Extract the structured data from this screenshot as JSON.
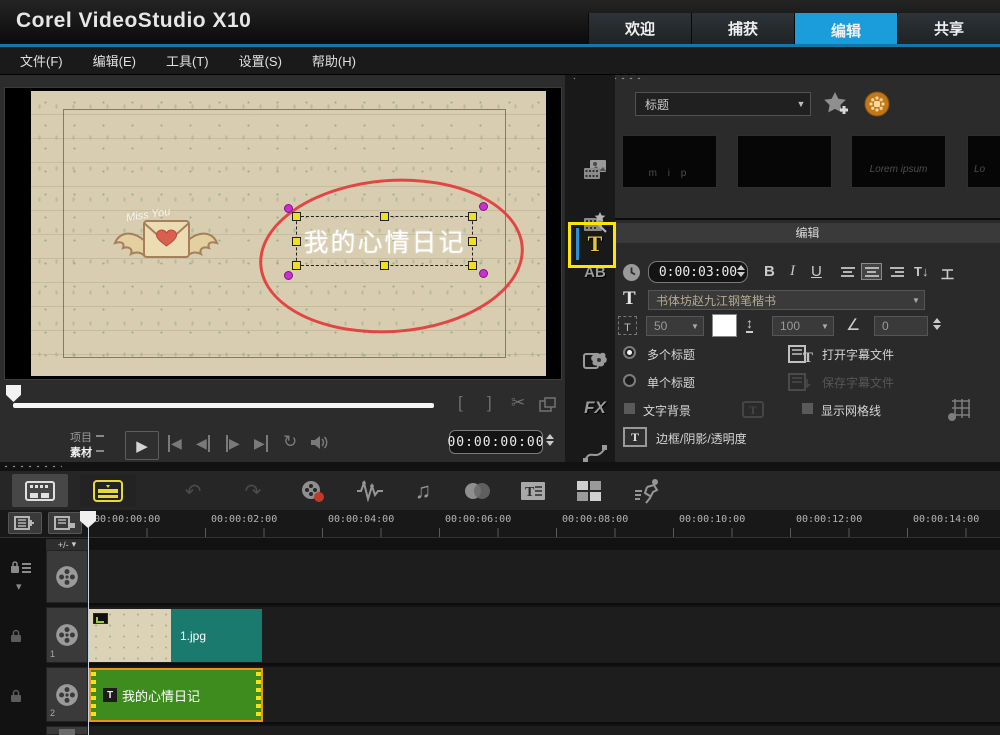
{
  "colors": {
    "accent_blue": "#1b9cdb",
    "highlight_yellow": "#ffe600",
    "annotation_red": "#e23b3b",
    "photo_clip_teal": "#1a7a6e",
    "title_clip_green": "#3f8c1e",
    "title_clip_border_orange": "#e8941e",
    "selection_handle_yellow": "#f0e11c",
    "selection_handle_magenta": "#cc2fd1"
  },
  "titlebar": {
    "logo": "Corel VideoStudio X10",
    "tabs": [
      {
        "label": "欢迎",
        "active": false
      },
      {
        "label": "捕获",
        "active": false
      },
      {
        "label": "编辑",
        "active": true
      },
      {
        "label": "共享",
        "active": false
      }
    ]
  },
  "menubar": {
    "items": [
      "文件(F)",
      "编辑(E)",
      "工具(T)",
      "设置(S)",
      "帮助(H)"
    ]
  },
  "preview": {
    "annotation_text": "Miss You",
    "selected_title_text": "我的心情日记",
    "mark_in": "[",
    "mark_out": "]",
    "project_label": "项目",
    "clip_label": "素材",
    "timecode": "00:00:00:00"
  },
  "library": {
    "category_selected": "标题",
    "thumbnails": [
      {
        "caption": "m  i  p"
      },
      {
        "caption": ""
      },
      {
        "caption": "Lorem ipsum"
      },
      {
        "caption": "Lo"
      }
    ]
  },
  "toolbox": {
    "ab_label": "AB",
    "title_label": "T",
    "fx_label": "FX"
  },
  "edit_panel": {
    "header": "编辑",
    "duration": "0:00:03:00",
    "bold_label": "B",
    "italic_label": "I",
    "underline_label": "U",
    "vertical_text_glyph": "T↓",
    "vertical_top_glyph": "工",
    "font_name": "书体坊赵九江钢笔楷书",
    "font_size": "50",
    "line_spacing": "100",
    "rotation_angle": "0",
    "multiple_titles_label": "多个标题",
    "single_title_label": "单个标题",
    "open_subtitle_label": "打开字幕文件",
    "save_subtitle_label": "保存字幕文件",
    "text_backdrop_label": "文字背景",
    "show_grid_label": "显示网格线",
    "border_shadow_label": "边框/阴影/透明度",
    "t_glyph": "T"
  },
  "icons": {
    "dropdown_arrow": "▼",
    "chevron_down": "▾",
    "scissors": "✂",
    "loop": "↻",
    "undo": "↶",
    "redo": "↷",
    "music": "♫",
    "play": "▶",
    "step_back": "◀",
    "step_fwd": "▶"
  },
  "timeline": {
    "track_manager_label": "+/-",
    "ruler_labels": [
      "00:00:00:00",
      "00:00:02:00",
      "00:00:04:00",
      "00:00:06:00",
      "00:00:08:00",
      "00:00:10:00",
      "00:00:12:00",
      "00:00:14:00"
    ],
    "tracks": [
      {
        "number": ""
      },
      {
        "number": "1"
      },
      {
        "number": "2"
      }
    ],
    "image_clip_name": "1.jpg",
    "title_clip_name": "我的心情日记",
    "title_clip_badge": "T"
  }
}
